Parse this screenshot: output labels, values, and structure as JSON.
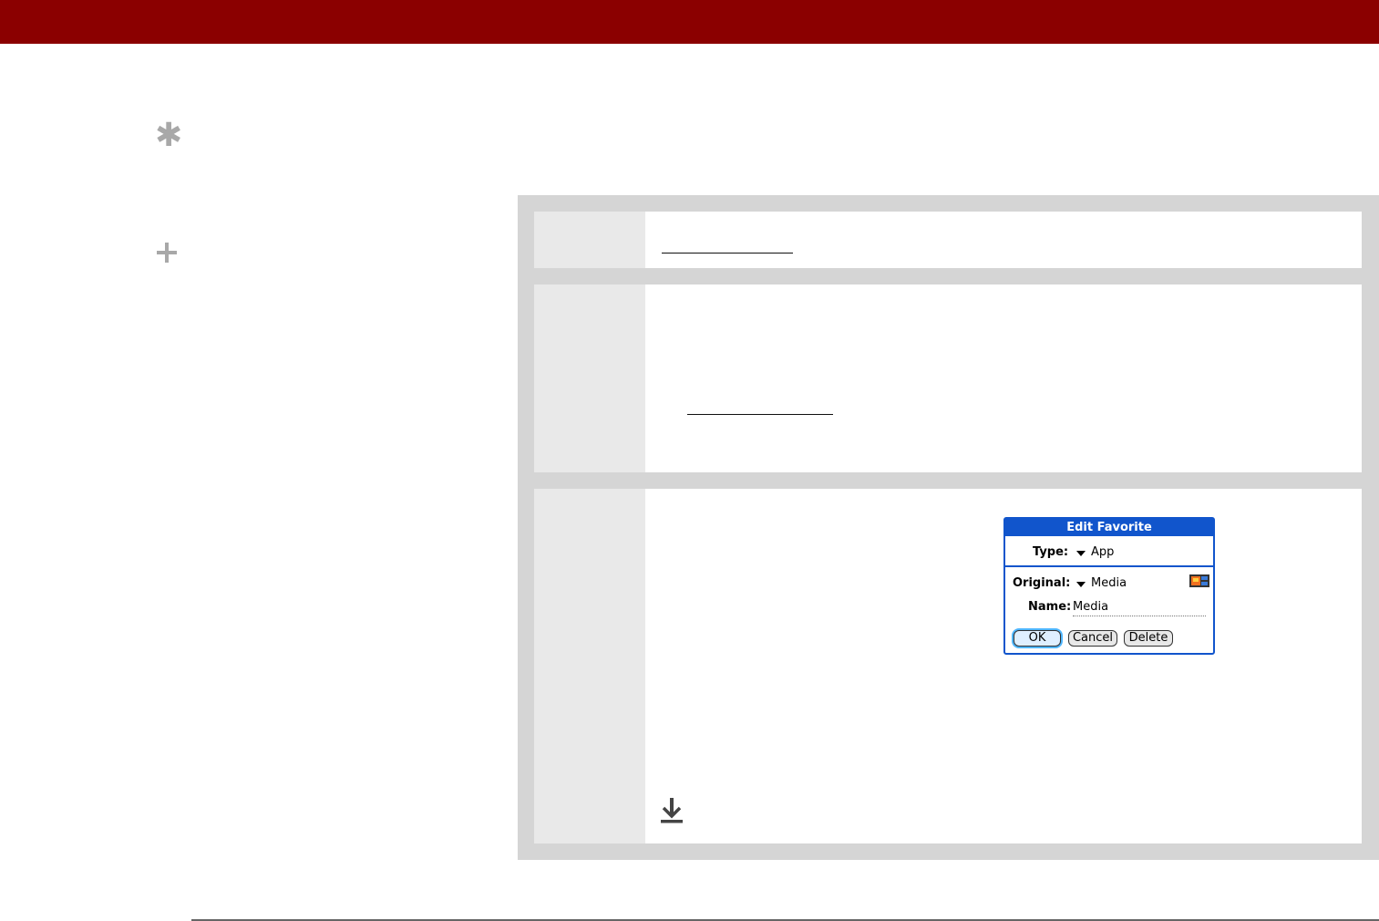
{
  "colors": {
    "banner": "#8b0000",
    "panel": "#d5d5d5",
    "step_number_cell": "#e9e9e9",
    "dialog_accent": "#1155cc",
    "margin_icon": "#a8a8a8"
  },
  "margin_icons": [
    "asterisk-tip-icon",
    "plus-did-you-know-icon"
  ],
  "steps": [
    {
      "number": "",
      "content": ""
    },
    {
      "number": "",
      "content": ""
    },
    {
      "number": "",
      "content": ""
    }
  ],
  "dialog": {
    "title": "Edit Favorite",
    "type_label": "Type:",
    "type_value": "App",
    "original_label": "Original:",
    "original_value": "Media",
    "name_label": "Name:",
    "name_value": "Media",
    "ok_label": "OK",
    "cancel_label": "Cancel",
    "delete_label": "Delete"
  },
  "icons": {
    "dropdown": "triangle-down-icon",
    "media": "media-app-icon",
    "continued": "down-arrow-continue-icon"
  }
}
